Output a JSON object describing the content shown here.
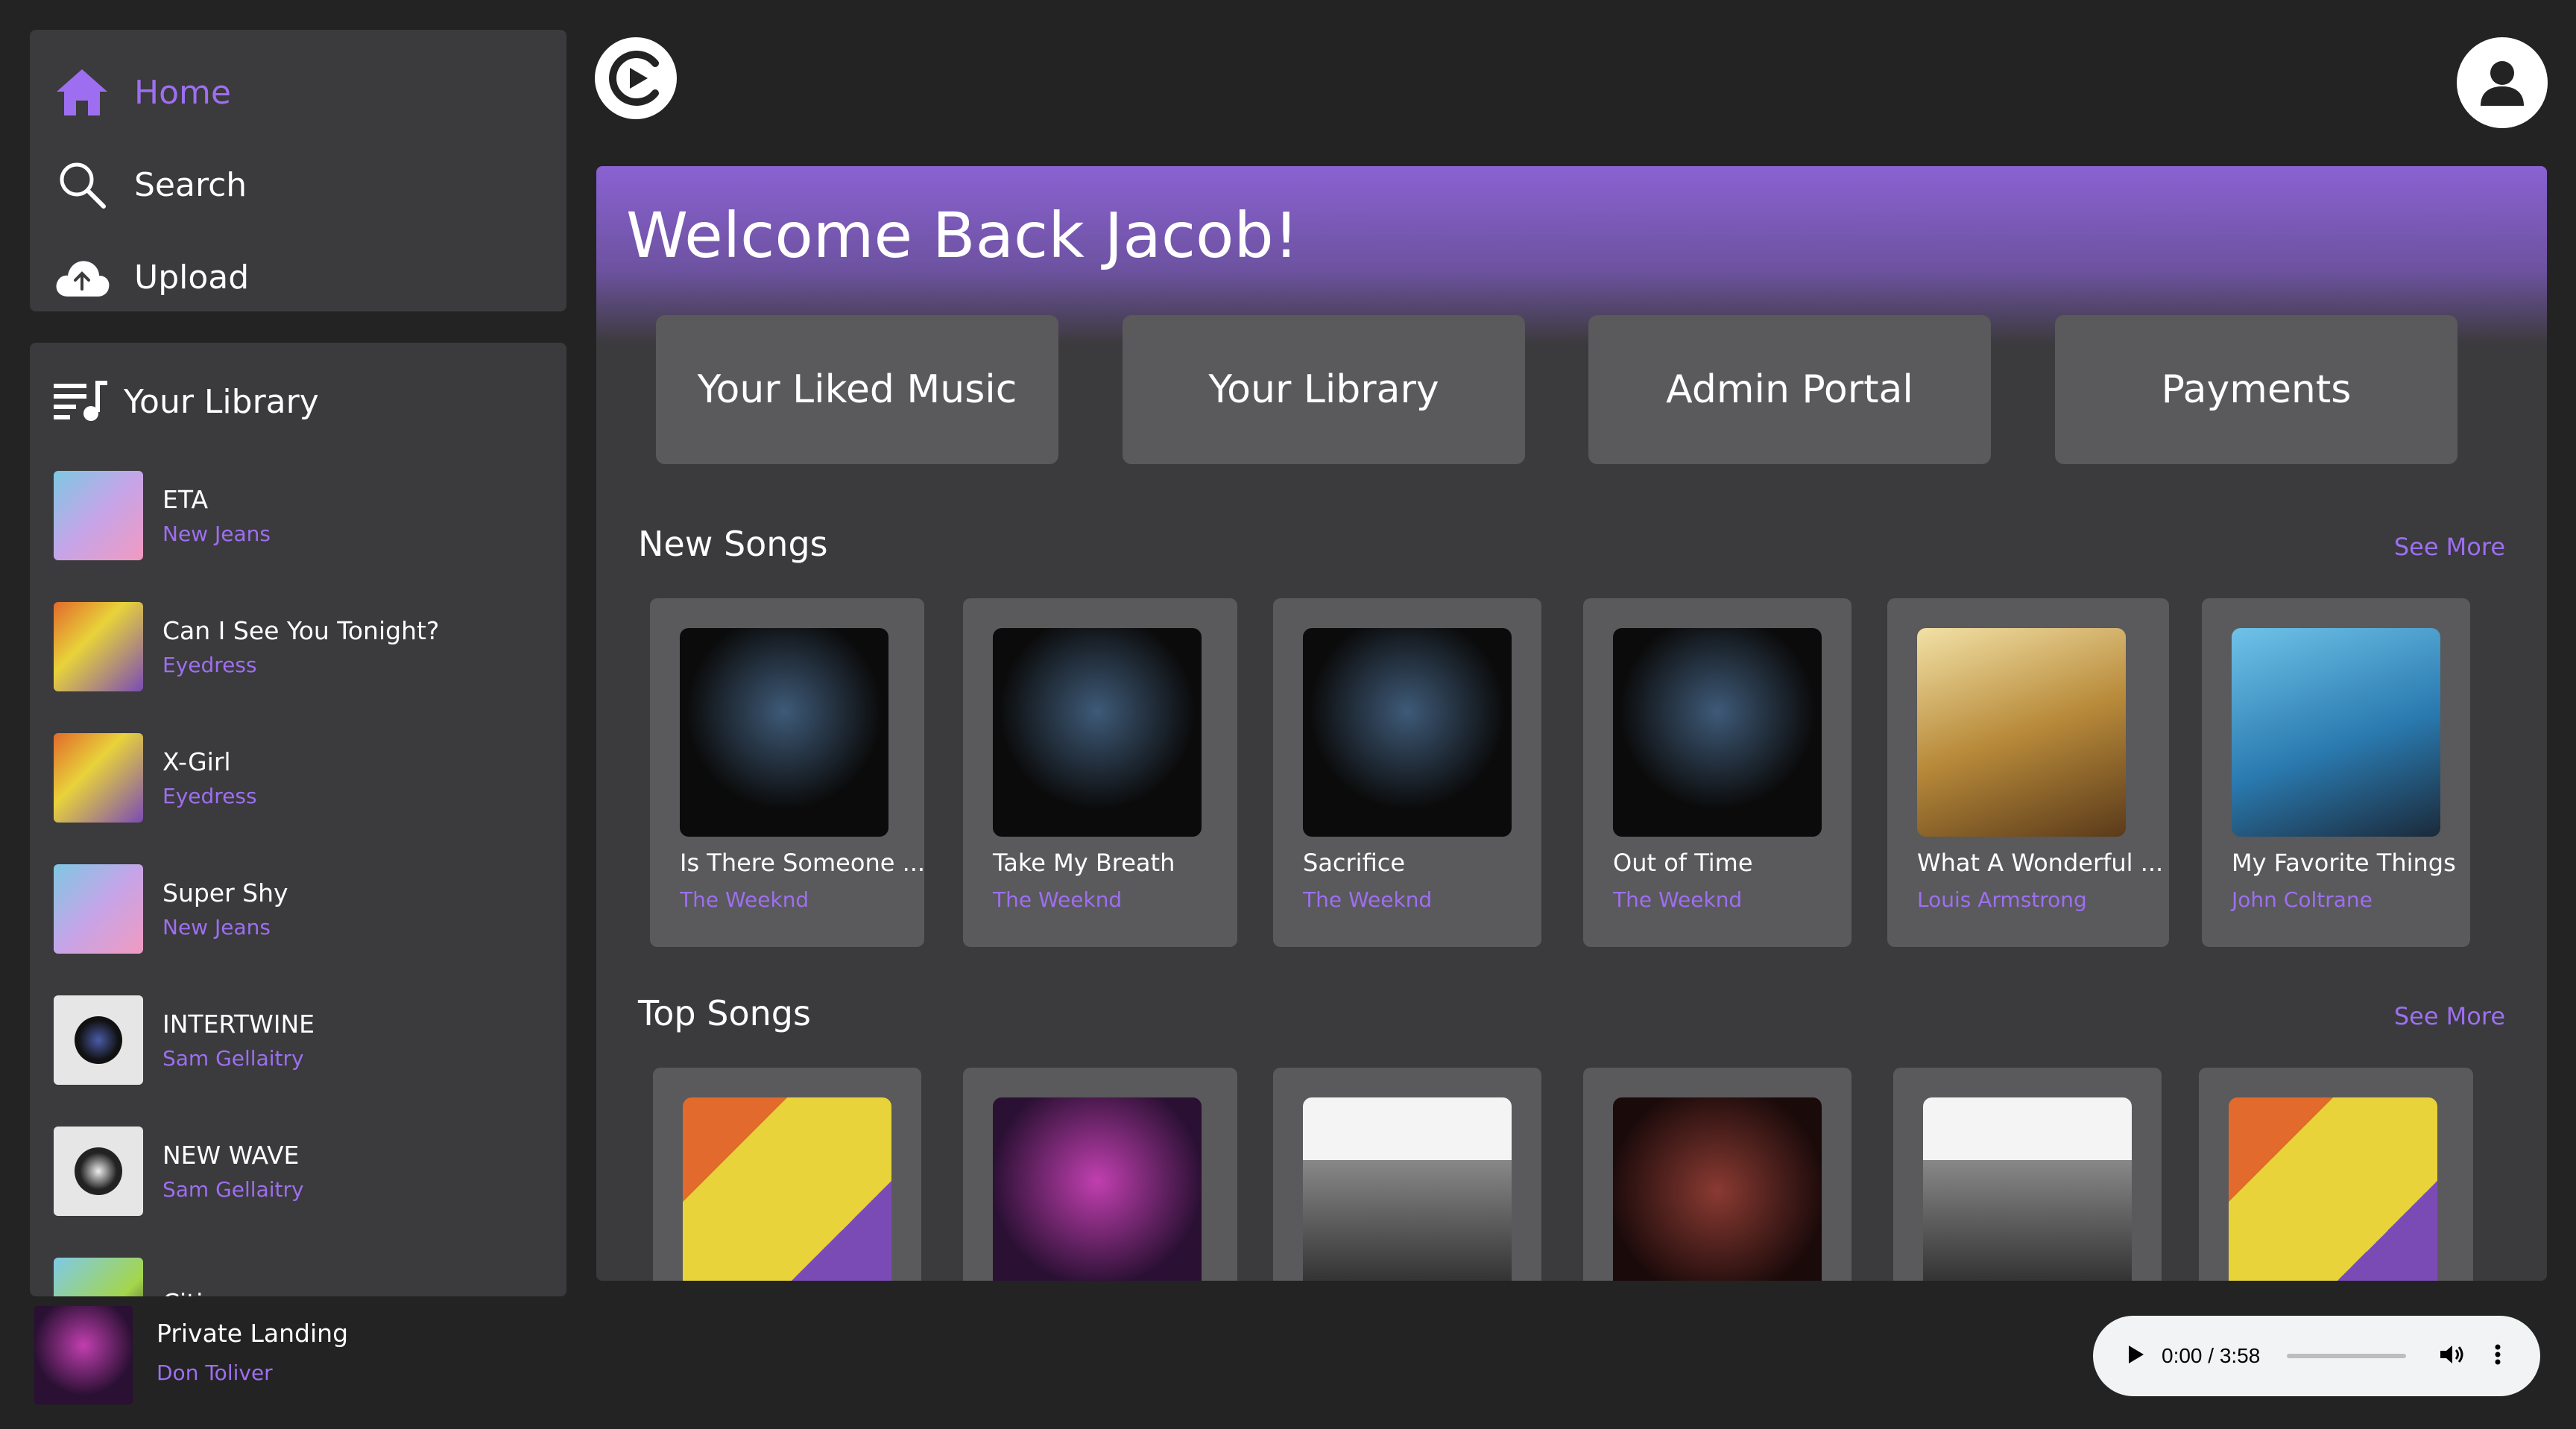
{
  "nav": {
    "items": [
      {
        "label": "Home",
        "icon": "home-icon",
        "active": true
      },
      {
        "label": "Search",
        "icon": "search-icon",
        "active": false
      },
      {
        "label": "Upload",
        "icon": "cloud-upload-icon",
        "active": false
      }
    ]
  },
  "library": {
    "title": "Your Library",
    "icon": "playlist-icon",
    "items": [
      {
        "title": "ETA",
        "artist": "New Jeans",
        "color": "#7ec8e3"
      },
      {
        "title": "Can I See You Tonight?",
        "artist": "Eyedress",
        "color": "#e8d33a"
      },
      {
        "title": "X-Girl",
        "artist": "Eyedress",
        "color": "#e8d33a"
      },
      {
        "title": "Super Shy",
        "artist": "New Jeans",
        "color": "#7ec8e3"
      },
      {
        "title": "INTERTWINE",
        "artist": "Sam Gellaitry",
        "color": "#e6e6e6"
      },
      {
        "title": "NEW WAVE",
        "artist": "Sam Gellaitry",
        "color": "#e6e6e6"
      },
      {
        "title": "Cities",
        "artist": "",
        "color": "#7fc9e8"
      }
    ]
  },
  "header": {
    "logo_icon": "play-logo-icon",
    "avatar_icon": "user-avatar-icon"
  },
  "main": {
    "welcome": "Welcome Back Jacob!",
    "quick_links": [
      "Your Liked Music",
      "Your Library",
      "Admin Portal",
      "Payments"
    ],
    "new_songs": {
      "title": "New Songs",
      "see_more": "See More",
      "items": [
        {
          "title": "Is There Someone ...",
          "artist": "The Weeknd"
        },
        {
          "title": "Take My Breath",
          "artist": "The Weeknd"
        },
        {
          "title": "Sacrifice",
          "artist": "The Weeknd"
        },
        {
          "title": "Out of Time",
          "artist": "The Weeknd"
        },
        {
          "title": "What A Wonderful ...",
          "artist": "Louis Armstrong"
        },
        {
          "title": "My Favorite Things",
          "artist": "John Coltrane"
        }
      ]
    },
    "top_songs": {
      "title": "Top Songs",
      "see_more": "See More"
    }
  },
  "now_playing": {
    "title": "Private Landing",
    "artist": "Don Toliver",
    "time": "0:00 / 3:58"
  },
  "colors": {
    "accent": "#9d6ff0",
    "background": "#232323",
    "panel": "#3b3a3c",
    "card": "#5a595b"
  }
}
